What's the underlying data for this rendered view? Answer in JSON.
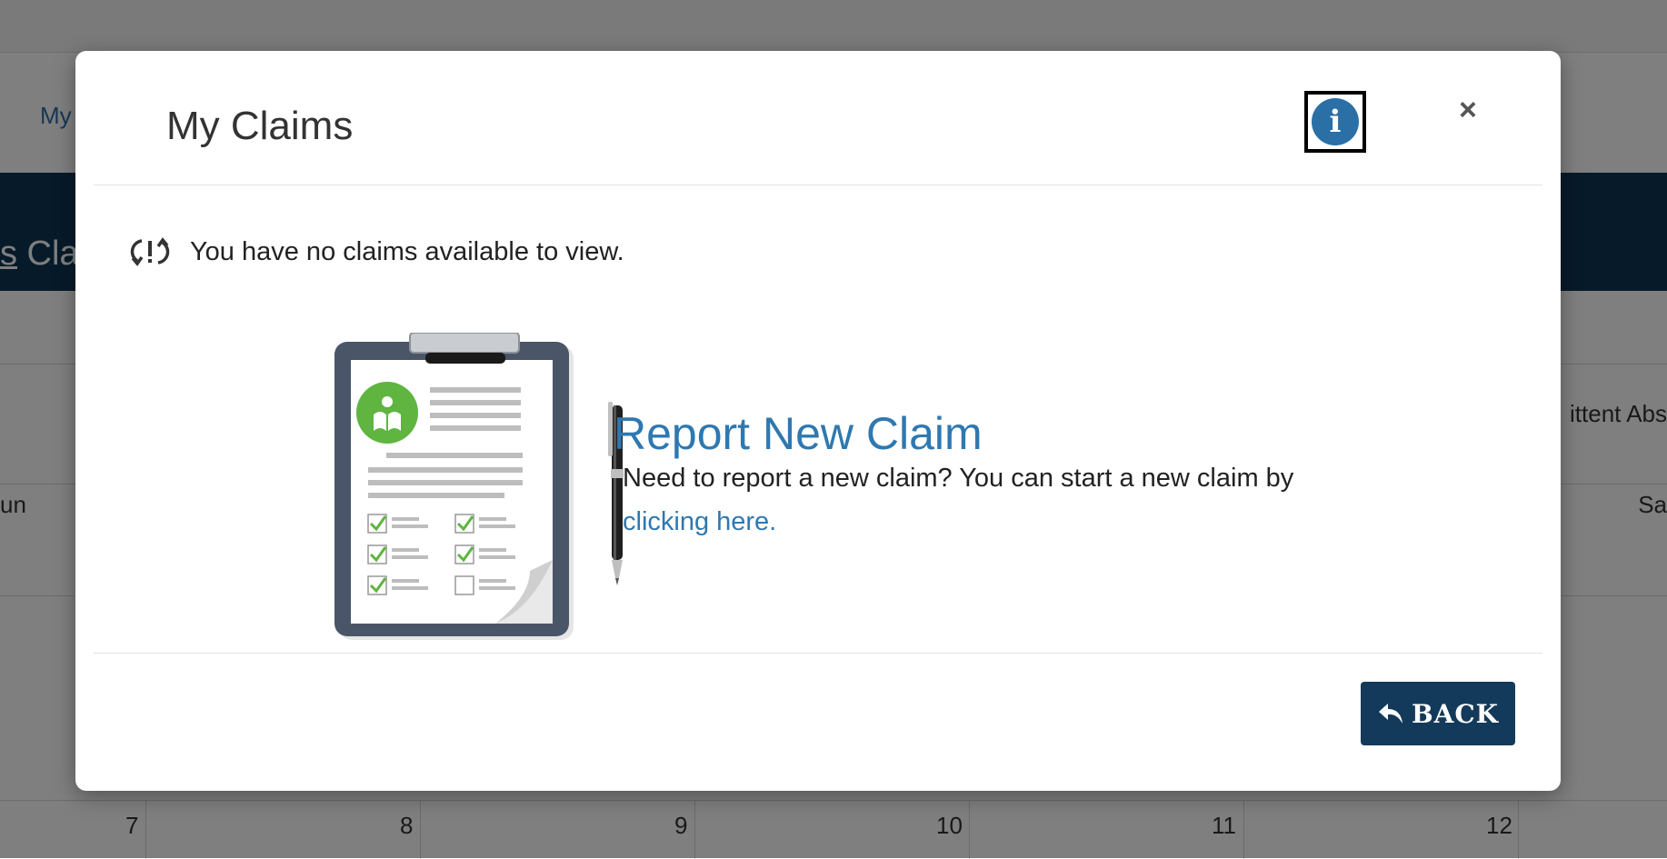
{
  "background": {
    "nav_link": "My",
    "band_prefix": "s",
    "band_text": " Cla",
    "right_label": "ittent Abs",
    "day_left": "un",
    "day_right": "Sa",
    "dates": [
      "7",
      "8",
      "9",
      "10",
      "11",
      "12"
    ]
  },
  "modal": {
    "title": "My Claims",
    "info_icon": "info-icon",
    "close_label": "×",
    "empty_message": "You have no claims available to view.",
    "report": {
      "title": "Report New Claim",
      "description": "Need to report a new claim? You can start a new claim by",
      "link_text": "clicking here."
    },
    "back_label": "BACK"
  },
  "colors": {
    "accent": "#2f78b0",
    "info_circle": "#2a6fa6",
    "dark_navy": "#133a5a",
    "band": "#0f3554"
  }
}
